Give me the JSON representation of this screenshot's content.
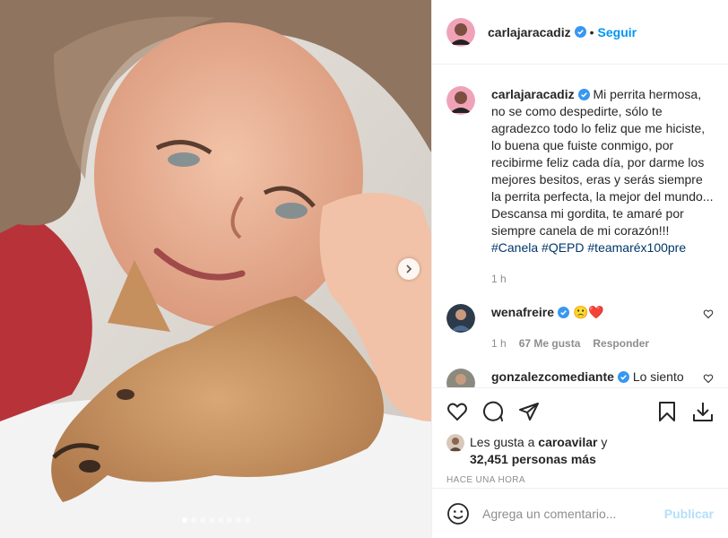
{
  "post": {
    "author": "carlajaracadiz",
    "follow_label": "Seguir",
    "separator": "•",
    "caption": "Mi perrita hermosa, no se como despedirte, sólo te agradezco todo lo feliz que me hiciste, lo buena que fuiste conmigo, por recibirme feliz cada día, por darme los mejores besitos, eras y serás siempre la perrita perfecta, la mejor del mundo... Descansa mi gordita, te amaré por siempre canela de mi corazón!!!",
    "hashtags": "#Canela #QEPD #teamaréx100pre",
    "caption_time": "1 h",
    "carousel": {
      "count": 8,
      "active_index": 0
    }
  },
  "comments": [
    {
      "user": "wenafreire",
      "text": "🙁❤️",
      "time": "1 h",
      "likes": "67 Me gusta",
      "reply_label": "Responder"
    },
    {
      "user": "gonzalezcomediante",
      "text": "Lo siento mucho Carlita, Ánimo y fuerza!!"
    }
  ],
  "likes": {
    "prefix": "Les gusta a",
    "user": "caroavilar",
    "and": "y",
    "others": "32,451 personas más"
  },
  "timestamp": "Hace una hora",
  "add_comment": {
    "placeholder": "Agrega un comentario...",
    "publish_label": "Publicar"
  },
  "colors": {
    "accent": "#0095f6",
    "hashtag": "#00376b",
    "muted": "#8e8e8e",
    "like_red": "#ed4956"
  },
  "icons": [
    "verified-badge-icon",
    "heart-icon",
    "comment-icon",
    "share-icon",
    "bookmark-icon",
    "download-icon",
    "emoji-icon",
    "chevron-right-icon"
  ]
}
